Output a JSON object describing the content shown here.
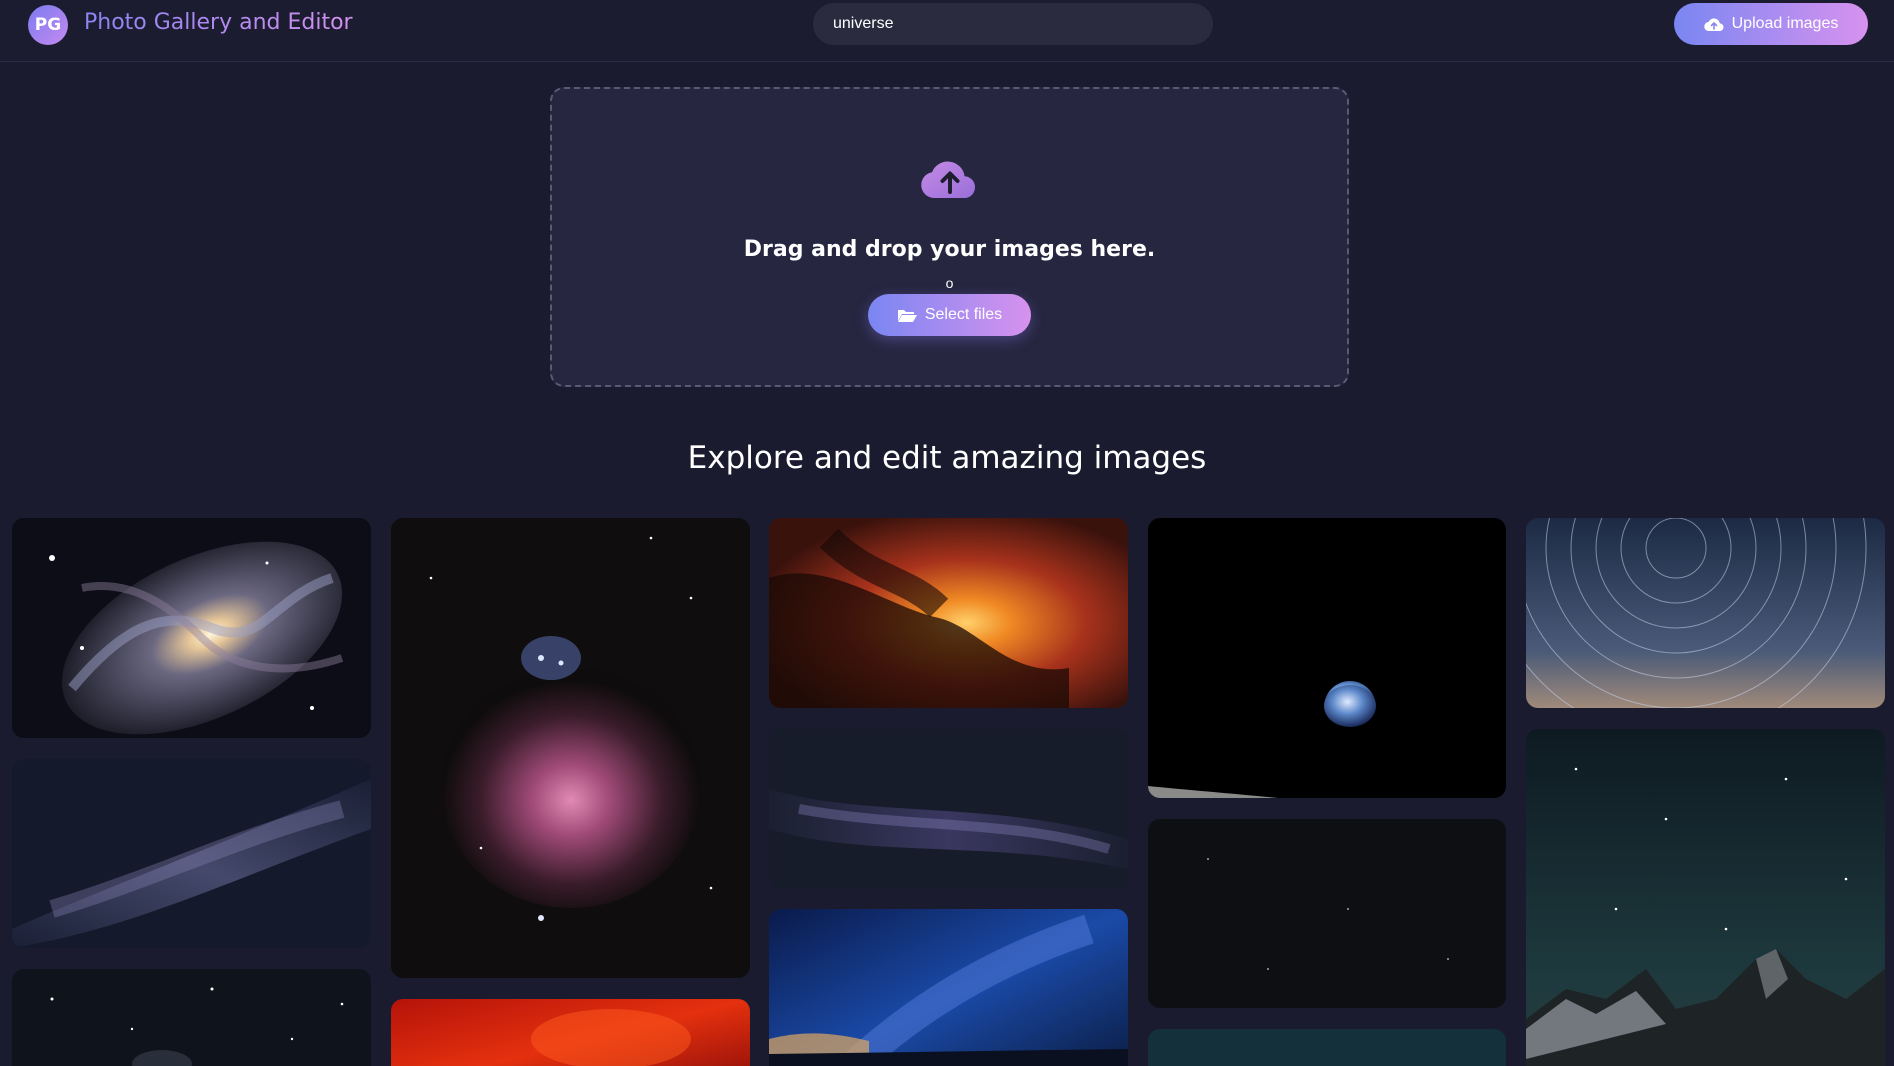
{
  "header": {
    "logo_text": "PG",
    "app_title": "Photo Gallery and Editor",
    "search_value": "universe",
    "upload_button_label": "Upload images"
  },
  "dropzone": {
    "icon": "cloud-upload-icon",
    "heading": "Drag and drop your images here.",
    "separator": "o",
    "select_button_label": "Select files",
    "select_button_icon": "folder-open-icon"
  },
  "gallery": {
    "title": "Explore and edit amazing images",
    "images": [
      {
        "subject": "spiral galaxy"
      },
      {
        "subject": "orion nebula"
      },
      {
        "subject": "fiery nebula"
      },
      {
        "subject": "earthrise over moon"
      },
      {
        "subject": "star trails"
      },
      {
        "subject": "milky way"
      },
      {
        "subject": "milky way panorama"
      },
      {
        "subject": "dark star field"
      },
      {
        "subject": "starry mountain peaks"
      },
      {
        "subject": "starry night"
      },
      {
        "subject": "red nebula"
      },
      {
        "subject": "blue milky way over horizon"
      },
      {
        "subject": "teal night sky"
      }
    ]
  },
  "colors": {
    "background": "#1b1b2f",
    "accent_start": "#7a86f2",
    "accent_end": "#d792ee"
  }
}
